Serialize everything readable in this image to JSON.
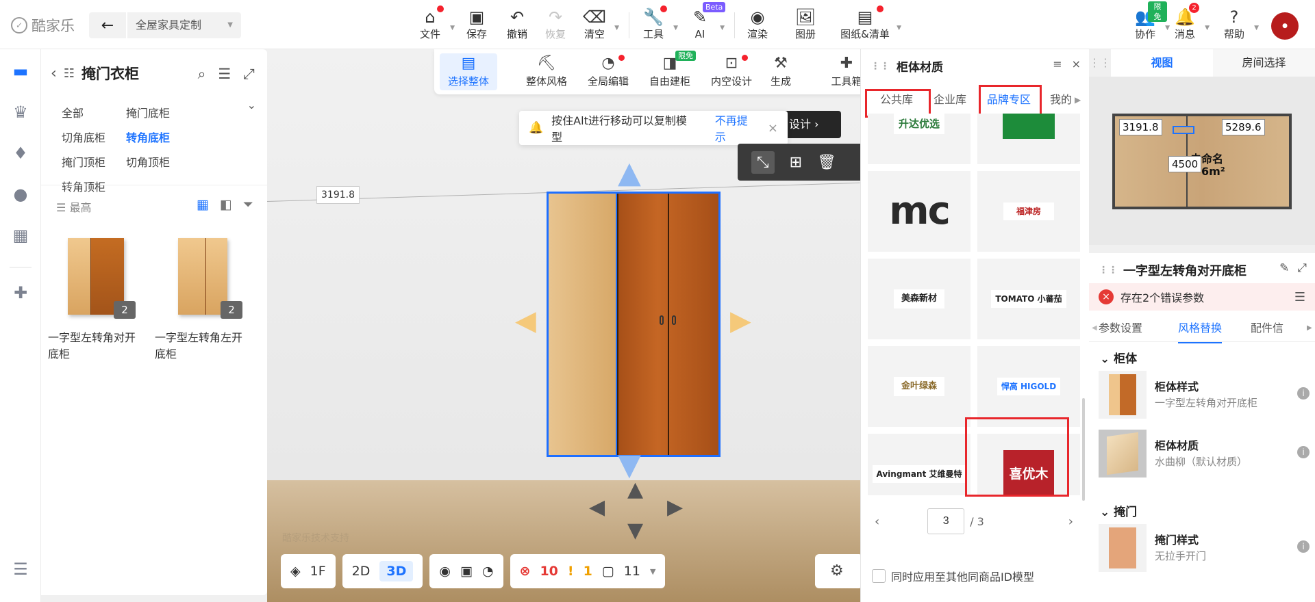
{
  "app": {
    "logo": "酷家乐",
    "scene": "全屋家具定制"
  },
  "toolbar": {
    "file": "文件",
    "save": "保存",
    "undo": "撤销",
    "redo": "恢复",
    "clear": "清空",
    "tools": "工具",
    "ai": "AI",
    "ai_tag": "Beta",
    "render": "渲染",
    "gallery": "图册",
    "drawings": "图纸&清单",
    "collab": "协作",
    "collab_tag": "限免",
    "messages": "消息",
    "messages_count": "2",
    "help": "帮助"
  },
  "catalog": {
    "title": "掩门衣柜",
    "categories": [
      "全部",
      "掩门底柜",
      "切角底柜",
      "转角底柜",
      "掩门顶柜",
      "切角顶柜",
      "转角顶柜"
    ],
    "active_category": "转角底柜",
    "sort": "最高",
    "items": [
      {
        "name": "一字型左转角对开底柜",
        "count": "2"
      },
      {
        "name": "一字型左转角左开底柜",
        "count": "2"
      }
    ]
  },
  "viewport": {
    "tools": [
      {
        "label": "选择整体",
        "active": true
      },
      {
        "label": "整体风格"
      },
      {
        "label": "全局编辑"
      },
      {
        "label": "自由建柜",
        "tag": "限免"
      },
      {
        "label": "内空设计"
      },
      {
        "label": "生成"
      },
      {
        "label": "工具箱"
      }
    ],
    "hint_text": "按住Alt进行移动可以复制模型",
    "hint_dismiss": "不再提示",
    "design_button": "设计",
    "dimension": "3191.8",
    "watermark": "酷家乐技术支持",
    "floor": "1F",
    "mode_2d": "2D",
    "mode_3d": "3D",
    "errors": "10",
    "warnings": "1",
    "items": "11"
  },
  "materials": {
    "title": "柜体材质",
    "tabs": [
      "公共库",
      "企业库",
      "品牌专区",
      "我的"
    ],
    "active_tab": "品牌专区",
    "brands": [
      {
        "name": "升达优选"
      },
      {
        "name": ""
      },
      {
        "name": "mc"
      },
      {
        "name": "福津房"
      },
      {
        "name": "美森新材"
      },
      {
        "name": "TOMATO 小蕃茄"
      },
      {
        "name": "金叶绿森"
      },
      {
        "name": "悍高 HIGOLD"
      },
      {
        "name": "Avingmant 艾维曼特"
      },
      {
        "name": "喜优木"
      }
    ],
    "page": "3",
    "total_pages": "/ 3",
    "apply_all": "同时应用至其他同商品ID模型"
  },
  "plan": {
    "tabs": [
      "视图",
      "房间选择"
    ],
    "active_tab": "视图",
    "dim_left": "3191.8",
    "dim_right": "5289.6",
    "dim_mid": "4500",
    "room_name": "未命名",
    "room_area": "6m²"
  },
  "properties": {
    "title": "一字型左转角对开底柜",
    "error_text": "存在2个错误参数",
    "tabs": [
      "参数设置",
      "风格替换",
      "配件信"
    ],
    "active_tab": "风格替换",
    "sections": [
      {
        "title": "柜体",
        "items": [
          {
            "name": "柜体样式",
            "value": "一字型左转角对开底柜"
          },
          {
            "name": "柜体材质",
            "value": "水曲柳（默认材质）"
          }
        ]
      },
      {
        "title": "掩门",
        "items": [
          {
            "name": "掩门样式",
            "value": "无拉手开门"
          }
        ]
      }
    ]
  },
  "colors": {
    "accent": "#1d73ff",
    "error": "#e53935",
    "highlight_box": "#e8262b"
  }
}
